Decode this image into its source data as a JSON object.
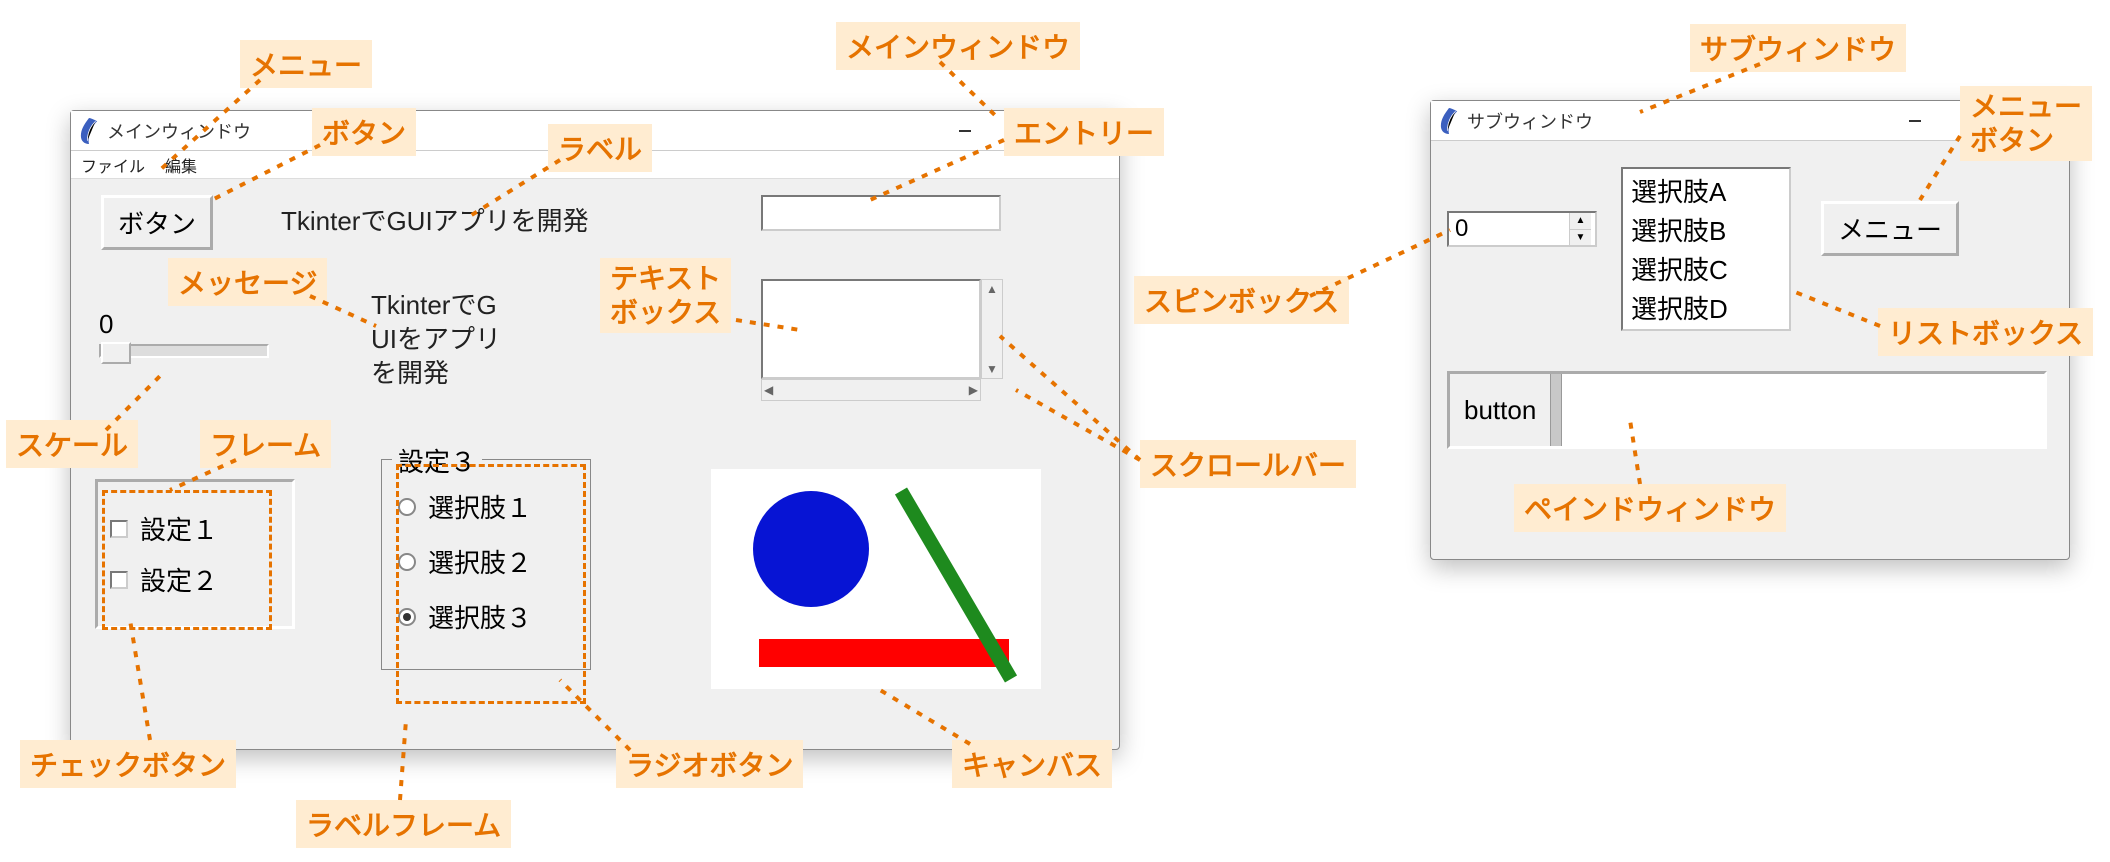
{
  "callouts": {
    "menu": "メニュー",
    "button": "ボタン",
    "label": "ラベル",
    "main_window": "メインウィンドウ",
    "entry": "エントリー",
    "message": "メッセージ",
    "textbox": "テキスト\nボックス",
    "scale": "スケール",
    "frame": "フレーム",
    "checkbutton": "チェックボタン",
    "labelframe": "ラベルフレーム",
    "radiobutton": "ラジオボタン",
    "canvas": "キャンバス",
    "scrollbar": "スクロールバー",
    "spinbox": "スピンボックス",
    "sub_window": "サブウィンドウ",
    "menubutton": "メニュー\nボタン",
    "listbox": "リストボックス",
    "panedwindow": "ペインドウィンドウ"
  },
  "main_window": {
    "title": "メインウィンドウ",
    "menubar": {
      "file": "ファイル",
      "edit": "編集"
    },
    "button_label": "ボタン",
    "label_text": "TkinterでGUIアプリを開発",
    "message_text": "TkinterでG\nUIをアプリ\nを開発",
    "scale_value": "0",
    "frame": {
      "check1": "設定１",
      "check2": "設定２"
    },
    "labelframe": {
      "title": "設定３",
      "radio1": "選択肢１",
      "radio2": "選択肢２",
      "radio3": "選択肢３",
      "selected_index": 2
    }
  },
  "sub_window": {
    "title": "サブウィンドウ",
    "spinbox_value": "0",
    "listbox_items": [
      "選択肢A",
      "選択肢B",
      "選択肢C",
      "選択肢D"
    ],
    "menubutton_label": "メニュー",
    "paned_left_label": "button"
  }
}
